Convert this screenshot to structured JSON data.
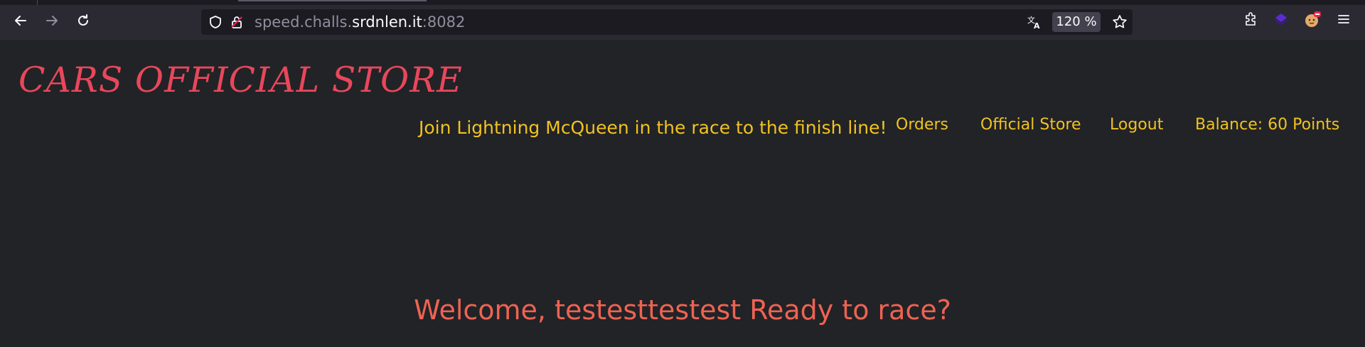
{
  "browser": {
    "url_prefix": "speed.challs.",
    "url_domain": "srdnlen.it",
    "url_port": ":8082",
    "zoom_level": "120 %",
    "icons": [
      "back-icon",
      "forward-icon",
      "reload-icon",
      "shield-icon",
      "insecure-lock-icon",
      "translate-icon",
      "bookmark-star-icon",
      "extensions-icon",
      "extension-purple-icon",
      "profile-avatar-icon",
      "menu-icon"
    ]
  },
  "header": {
    "site_title": "CARS OFFICIAL STORE",
    "tagline": "Join Lightning McQueen in the race to the finish line!"
  },
  "nav": {
    "orders": "Orders",
    "official_store": "Official Store",
    "logout": "Logout",
    "balance": "Balance: 60 Points"
  },
  "main": {
    "welcome": "Welcome, testesttestest Ready to race?"
  },
  "colors": {
    "background": "#212327",
    "title": "#e8475b",
    "nav_text": "#f2c21f",
    "welcome_text": "#ee6352",
    "chrome": "#2b2a33"
  }
}
